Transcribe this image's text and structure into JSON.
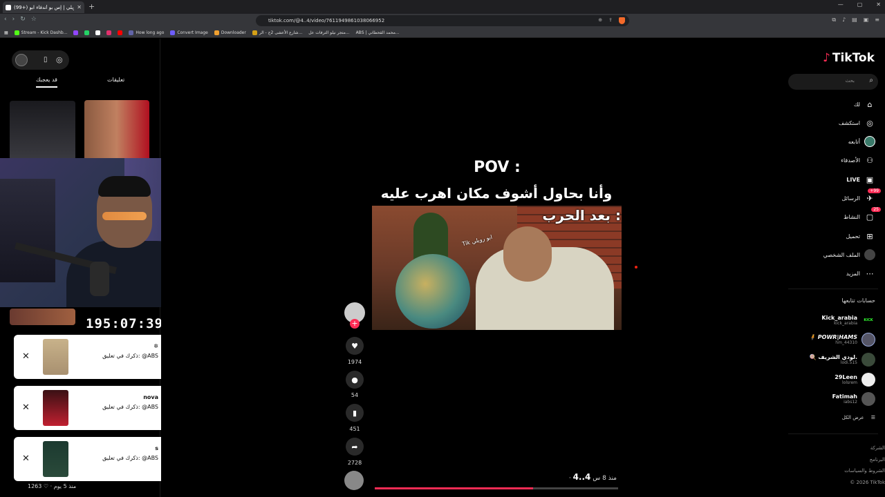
{
  "browser": {
    "tab_title": "(99+) ابو رويلي | إس بو أندفاء ابو",
    "new_tab": "+",
    "url": "tiktok.com/@4..4/video/7611949861038066952",
    "bookmarks": [
      "Stream - Kick Dashb...",
      "How long ago",
      "Convert Image",
      "Downloader",
      "شارع الأعشى 2ج - الر...",
      "متجر نيلو الترفات عل...",
      "ABS | محمد القحطاني..."
    ]
  },
  "left_panel": {
    "tab_comments": "تعليقات",
    "tab_liked": "قد يعجبك",
    "timer": "195:07:39",
    "notifications": [
      {
        "name": "✲",
        "message": "ذكرك في تعليق: @ABS"
      },
      {
        "name": "nova",
        "message": "ذكرك في تعليق: @ABS"
      },
      {
        "name": "s",
        "message": "ذكرك في تعليق: @ABS"
      }
    ],
    "footer_stats": "1263 ♡ · منذ 5 يوم"
  },
  "video": {
    "pov_line1": "POV :",
    "pov_line2": "وأنا بحاول أشوف مكان اهرب عليه",
    "caption": "بعد الحرب :",
    "watermark": "Tik ابو رويلي",
    "likes": "1974",
    "comments": "54",
    "saves": "451",
    "shares": "2728",
    "author": "4..4",
    "time_ago": "· منذ 8 س",
    "progress": 0.65
  },
  "sidebar": {
    "logo": "TikTok",
    "search_placeholder": "بحث",
    "menu": [
      {
        "label": "لك",
        "icon": "home-icon"
      },
      {
        "label": "استكشف",
        "icon": "compass-icon"
      },
      {
        "label": "أتابعه",
        "icon": "avatar-icon"
      },
      {
        "label": "الأصدقاء",
        "icon": "friends-icon"
      },
      {
        "label": "LIVE",
        "icon": "live-icon"
      },
      {
        "label": "الرسائل",
        "icon": "message-icon",
        "badge": "+99"
      },
      {
        "label": "النشاط",
        "icon": "activity-icon",
        "badge": "25"
      },
      {
        "label": "تحميل",
        "icon": "upload-icon"
      },
      {
        "label": "الملف الشخصي",
        "icon": "profile-icon"
      },
      {
        "label": "المزيد",
        "icon": "more-icon"
      }
    ],
    "following_header": "حسابات تتابعها",
    "accounts": [
      {
        "name": "Kick_arabia",
        "handle": "kick_arabia",
        "avatar": "KICK"
      },
      {
        "name": "🧍 POWR|HAMS",
        "handle": "hm_44310",
        "avatar": ""
      },
      {
        "name": "🍭 لودي الشريف.",
        "handle": "lodi.515",
        "avatar": ""
      },
      {
        "name": "29Leen",
        "handle": "lolsrem",
        "avatar": ""
      },
      {
        "name": "Fatimah",
        "handle": "iabs12",
        "avatar": ""
      }
    ],
    "see_all": "عرض الكل",
    "footer": [
      "الشركة",
      "البرنامج",
      "الشروط والسياسات",
      "© 2026 TikTok"
    ]
  },
  "colors": {
    "accent": "#fe2c55",
    "kick_green": "#53fc18",
    "badge_gold": "#f2b233"
  }
}
